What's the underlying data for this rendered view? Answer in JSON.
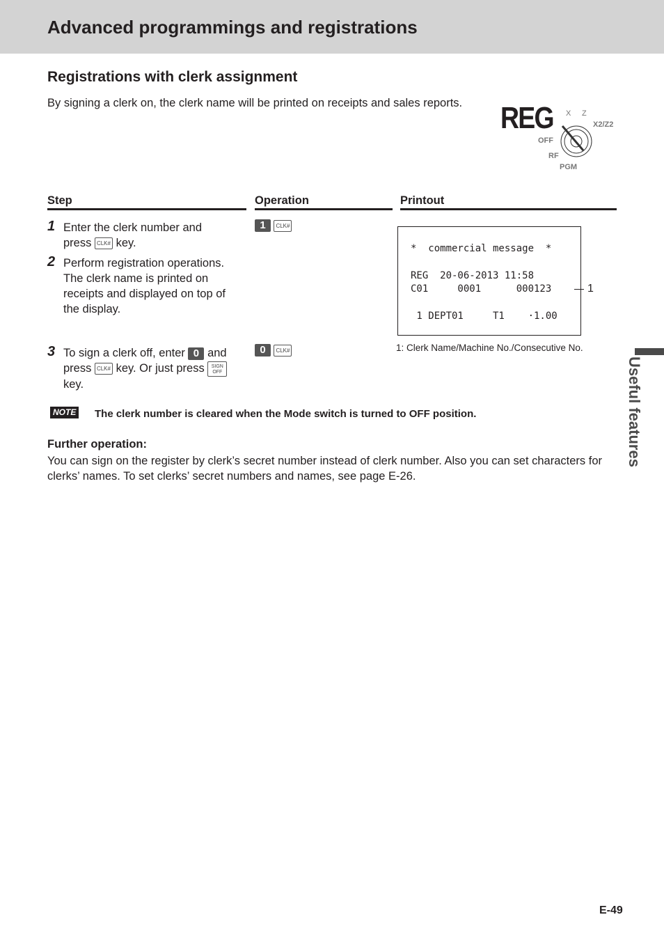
{
  "header": {
    "title": "Advanced programmings and registrations"
  },
  "section": {
    "title": "Registrations with clerk assignment",
    "intro": "By signing a clerk on, the clerk name will be printed on receipts and sales reports."
  },
  "mode_switch": {
    "label": "REG",
    "positions": [
      "X",
      "Z",
      "X2/Z2",
      "OFF",
      "RF",
      "PGM"
    ]
  },
  "columns": {
    "step": "Step",
    "operation": "Operation",
    "printout": "Printout"
  },
  "steps": [
    {
      "num": "1",
      "a": "Enter the clerk number and",
      "b": "press",
      "c": "key."
    },
    {
      "num": "2",
      "text": "Perform registration operations. The clerk name is printed on receipts and displayed on top of the display."
    },
    {
      "num": "3",
      "a": "To sign a clerk off, enter",
      "b": "and",
      "c": "press",
      "d": "key. Or just press",
      "e": "key."
    }
  ],
  "keys": {
    "clk": "CLK#",
    "one": "1",
    "zero": "0",
    "sign1": "SIGN",
    "sign2": "OFF"
  },
  "receipt": {
    "l1": "*  commercial message  *",
    "l2": "REG  20-06-2013 11:58",
    "l3": "C01     0001      000123",
    "l4": " 1 DEPT01     T1    ·1.00",
    "callout": "1"
  },
  "footnote": "1: Clerk Name/Machine No./Consecutive No.",
  "note": {
    "badge": "NOTE",
    "text": "The clerk number is cleared when the Mode switch is turned to OFF position."
  },
  "further": {
    "title": "Further operation:",
    "text": "You can sign on the register by clerk’s secret number instead of clerk number. Also you can set characters for clerks’ names. To set clerks’ secret numbers and names, see page E-26."
  },
  "side_tab": "Useful features",
  "page_number": "E-49"
}
